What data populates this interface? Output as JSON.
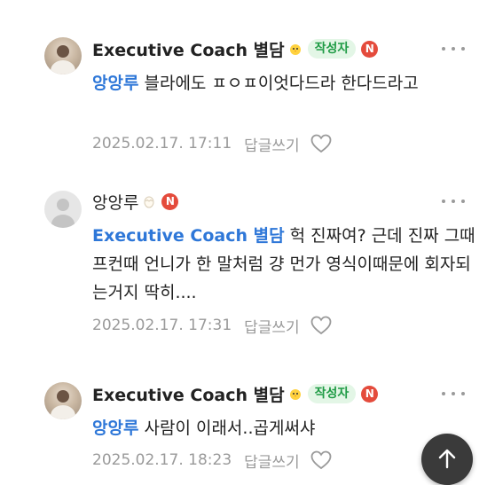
{
  "comments": [
    {
      "author": "Executive Coach 별담",
      "level_icon": "chick-icon",
      "author_badge": "작성자",
      "new_badge": "N",
      "mention": "앙앙루",
      "text": " 블라에도 ㅍㅇㅍ이엇다드라 한다드라고",
      "date": "2025.02.17. 17:11",
      "reply_label": "답글쓰기"
    },
    {
      "author": "앙앙루",
      "level_icon": "egg-icon",
      "new_badge": "N",
      "mention": "Executive Coach 별담",
      "text": " 헉 진짜여? 근데 진짜 그때 프컨때 언니가 한 말처럼 걍 먼가 영식이때문에 회자되는거지 딱히....",
      "date": "2025.02.17. 17:31",
      "reply_label": "답글쓰기"
    },
    {
      "author": "Executive Coach 별담",
      "level_icon": "chick-icon",
      "author_badge": "작성자",
      "new_badge": "N",
      "mention": "앙앙루",
      "text": " 사람이 이래서..곱게써샤",
      "date": "2025.02.17. 18:23",
      "reply_label": "답글쓰기"
    }
  ],
  "icons": {
    "more": "more-dots-icon",
    "like": "heart-icon",
    "scroll_top": "arrow-up-icon"
  },
  "colors": {
    "mention": "#2e77d8",
    "author_badge_bg": "#e3f6e6",
    "author_badge_text": "#1f9b45",
    "new_badge": "#e44b3c",
    "meta_text": "#9a9a9a"
  }
}
